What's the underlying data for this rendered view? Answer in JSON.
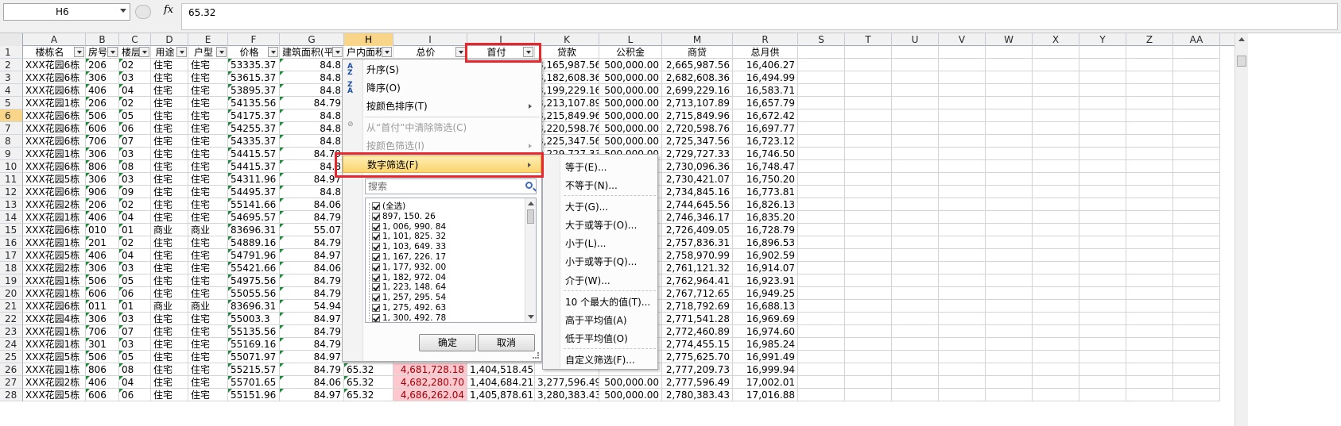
{
  "formula_bar": {
    "name_box": "H6",
    "fx": "fx",
    "value": "65.32"
  },
  "columns": [
    "A",
    "B",
    "C",
    "D",
    "E",
    "F",
    "G",
    "H",
    "I",
    "J",
    "K",
    "L",
    "M",
    "R",
    "S",
    "T",
    "U",
    "V",
    "W",
    "X",
    "Y",
    "Z",
    "AA"
  ],
  "active_column": "H",
  "active_row": "6",
  "header_row": {
    "num": "1",
    "cells": [
      "楼栋名",
      "房号",
      "楼层",
      "用途",
      "户型",
      "价格",
      "建筑面积(平",
      "户内面积",
      "总价",
      "首付",
      "贷款",
      "公积金",
      "商贷",
      "总月供"
    ]
  },
  "rows": [
    {
      "num": "2",
      "a": "XXX花园6栋",
      "b": "206",
      "c": "02",
      "d": "住宅",
      "e": "住宅",
      "f": "53335.37",
      "g": "84.8",
      "k": "3,165,987.56",
      "l": "500,000.00",
      "m": "2,665,987.56",
      "r": "16,406.27"
    },
    {
      "num": "3",
      "a": "XXX花园6栋",
      "b": "306",
      "c": "03",
      "d": "住宅",
      "e": "住宅",
      "f": "53615.37",
      "g": "84.8",
      "k": "3,182,608.36",
      "l": "500,000.00",
      "m": "2,682,608.36",
      "r": "16,494.99"
    },
    {
      "num": "4",
      "a": "XXX花园6栋",
      "b": "406",
      "c": "04",
      "d": "住宅",
      "e": "住宅",
      "f": "53895.37",
      "g": "84.8",
      "k": "3,199,229.16",
      "l": "500,000.00",
      "m": "2,699,229.16",
      "r": "16,583.71"
    },
    {
      "num": "5",
      "a": "XXX花园1栋",
      "b": "206",
      "c": "02",
      "d": "住宅",
      "e": "住宅",
      "f": "54135.56",
      "g": "84.79",
      "k": "3,213,107.89",
      "l": "500,000.00",
      "m": "2,713,107.89",
      "r": "16,657.79"
    },
    {
      "num": "6",
      "a": "XXX花园6栋",
      "b": "506",
      "c": "05",
      "d": "住宅",
      "e": "住宅",
      "f": "54175.37",
      "g": "84.8",
      "k": "3,215,849.96",
      "l": "500,000.00",
      "m": "2,715,849.96",
      "r": "16,672.42"
    },
    {
      "num": "7",
      "a": "XXX花园6栋",
      "b": "606",
      "c": "06",
      "d": "住宅",
      "e": "住宅",
      "f": "54255.37",
      "g": "84.8",
      "k": "3,220,598.76",
      "l": "500,000.00",
      "m": "2,720,598.76",
      "r": "16,697.77"
    },
    {
      "num": "8",
      "a": "XXX花园6栋",
      "b": "706",
      "c": "07",
      "d": "住宅",
      "e": "住宅",
      "f": "54335.37",
      "g": "84.8",
      "k": "3,225,347.56",
      "l": "500,000.00",
      "m": "2,725,347.56",
      "r": "16,723.12"
    },
    {
      "num": "9",
      "a": "XXX花园1栋",
      "b": "306",
      "c": "03",
      "d": "住宅",
      "e": "住宅",
      "f": "54415.57",
      "g": "84.79",
      "k": "3,229,727.33",
      "l": "500,000.00",
      "m": "2,729,727.33",
      "r": "16,746.50"
    },
    {
      "num": "10",
      "a": "XXX花园6栋",
      "b": "806",
      "c": "08",
      "d": "住宅",
      "e": "住宅",
      "f": "54415.37",
      "g": "84.8",
      "k": "",
      "l": "",
      "m": "2,730,096.36",
      "r": "16,748.47"
    },
    {
      "num": "11",
      "a": "XXX花园5栋",
      "b": "306",
      "c": "03",
      "d": "住宅",
      "e": "住宅",
      "f": "54311.96",
      "g": "84.97",
      "k": "",
      "l": "",
      "m": "2,730,421.07",
      "r": "16,750.20"
    },
    {
      "num": "12",
      "a": "XXX花园6栋",
      "b": "906",
      "c": "09",
      "d": "住宅",
      "e": "住宅",
      "f": "54495.37",
      "g": "84.8",
      "k": "",
      "l": "",
      "m": "2,734,845.16",
      "r": "16,773.81"
    },
    {
      "num": "13",
      "a": "XXX花园2栋",
      "b": "206",
      "c": "02",
      "d": "住宅",
      "e": "住宅",
      "f": "55141.66",
      "g": "84.06",
      "k": "",
      "l": "",
      "m": "2,744,645.56",
      "r": "16,826.13"
    },
    {
      "num": "14",
      "a": "XXX花园1栋",
      "b": "406",
      "c": "04",
      "d": "住宅",
      "e": "住宅",
      "f": "54695.57",
      "g": "84.79",
      "k": "",
      "l": "",
      "m": "2,746,346.17",
      "r": "16,835.20"
    },
    {
      "num": "15",
      "a": "XXX花园6栋",
      "b": "010",
      "c": "01",
      "d": "商业",
      "e": "商业",
      "f": "83696.31",
      "g": "55.07",
      "k": "",
      "l": "",
      "m": "2,726,409.05",
      "r": "16,728.79"
    },
    {
      "num": "16",
      "a": "XXX花园1栋",
      "b": "201",
      "c": "02",
      "d": "住宅",
      "e": "住宅",
      "f": "54889.16",
      "g": "84.79",
      "k": "",
      "l": "",
      "m": "2,757,836.31",
      "r": "16,896.53"
    },
    {
      "num": "17",
      "a": "XXX花园5栋",
      "b": "406",
      "c": "04",
      "d": "住宅",
      "e": "住宅",
      "f": "54791.96",
      "g": "84.97",
      "k": "",
      "l": "",
      "m": "2,758,970.99",
      "r": "16,902.59"
    },
    {
      "num": "18",
      "a": "XXX花园2栋",
      "b": "306",
      "c": "03",
      "d": "住宅",
      "e": "住宅",
      "f": "55421.66",
      "g": "84.06",
      "k": "",
      "l": "",
      "m": "2,761,121.32",
      "r": "16,914.07"
    },
    {
      "num": "19",
      "a": "XXX花园1栋",
      "b": "506",
      "c": "05",
      "d": "住宅",
      "e": "住宅",
      "f": "54975.56",
      "g": "84.79",
      "k": "",
      "l": "",
      "m": "2,762,964.41",
      "r": "16,923.91"
    },
    {
      "num": "20",
      "a": "XXX花园1栋",
      "b": "606",
      "c": "06",
      "d": "住宅",
      "e": "住宅",
      "f": "55055.56",
      "g": "84.79",
      "k": "",
      "l": "",
      "m": "2,767,712.65",
      "r": "16,949.25"
    },
    {
      "num": "21",
      "a": "XXX花园6栋",
      "b": "011",
      "c": "01",
      "d": "商业",
      "e": "商业",
      "f": "83696.31",
      "g": "54.94",
      "k": "",
      "l": "",
      "m": "2,718,792.69",
      "r": "16,688.13"
    },
    {
      "num": "22",
      "a": "XXX花园4栋",
      "b": "306",
      "c": "03",
      "d": "住宅",
      "e": "住宅",
      "f": "55003.3",
      "g": "84.97",
      "k": "",
      "l": "",
      "m": "2,771,541.28",
      "r": "16,969.69"
    },
    {
      "num": "23",
      "a": "XXX花园1栋",
      "b": "706",
      "c": "07",
      "d": "住宅",
      "e": "住宅",
      "f": "55135.56",
      "g": "84.79",
      "k": "",
      "l": "",
      "m": "2,772,460.89",
      "r": "16,974.60"
    },
    {
      "num": "24",
      "a": "XXX花园1栋",
      "b": "301",
      "c": "03",
      "d": "住宅",
      "e": "住宅",
      "f": "55169.16",
      "g": "84.79",
      "k": "",
      "l": "",
      "m": "2,774,455.15",
      "r": "16,985.24"
    },
    {
      "num": "25",
      "a": "XXX花园5栋",
      "b": "506",
      "c": "05",
      "d": "住宅",
      "e": "住宅",
      "f": "55071.97",
      "g": "84.97",
      "k": "",
      "l": "",
      "m": "2,775,625.70",
      "r": "16,991.49"
    },
    {
      "num": "26",
      "a": "XXX花园1栋",
      "b": "806",
      "c": "08",
      "d": "住宅",
      "e": "住宅",
      "f": "55215.57",
      "g": "84.79",
      "h": "65.32",
      "i": "4,681,728.18",
      "j": "1,404,518.45",
      "k": "",
      "l": "",
      "m": "2,777,209.73",
      "r": "16,999.94"
    },
    {
      "num": "27",
      "a": "XXX花园2栋",
      "b": "406",
      "c": "04",
      "d": "住宅",
      "e": "住宅",
      "f": "55701.65",
      "g": "84.06",
      "h": "65.32",
      "i": "4,682,280.70",
      "j": "1,404,684.21",
      "k": "3,277,596.49",
      "l": "500,000.00",
      "m": "2,777,596.49",
      "r": "17,002.01"
    },
    {
      "num": "28",
      "a": "XXX花园5栋",
      "b": "606",
      "c": "06",
      "d": "住宅",
      "e": "住宅",
      "f": "55151.96",
      "g": "84.97",
      "h": "65.32",
      "i": "4,686,262.04",
      "j": "1,405,878.61",
      "k": "3,280,383.43",
      "l": "500,000.00",
      "m": "2,780,383.43",
      "r": "17,016.88"
    }
  ],
  "filter_menu": {
    "sort_asc": "升序(S)",
    "sort_desc": "降序(O)",
    "sort_by_color": "按颜色排序(T)",
    "clear_filter": "从“首付”中清除筛选(C)",
    "filter_by_color": "按颜色筛选(I)",
    "number_filter": "数字筛选(F)",
    "search_placeholder": "搜索",
    "list": [
      "(全选)",
      "897, 150. 26",
      "1, 006, 990. 84",
      "1, 101, 825. 32",
      "1, 103, 649. 33",
      "1, 167, 226. 17",
      "1, 177, 932. 00",
      "1, 182, 972. 04",
      "1, 223, 148. 64",
      "1, 257, 295. 54",
      "1, 275, 492. 63",
      "1, 300, 492. 78"
    ],
    "ok": "确定",
    "cancel": "取消"
  },
  "number_filter_submenu": {
    "items": [
      "等于(E)...",
      "不等于(N)...",
      "大于(G)...",
      "大于或等于(O)...",
      "小于(L)...",
      "小于或等于(Q)...",
      "介于(W)...",
      "10 个最大的值(T)...",
      "高于平均值(A)",
      "低于平均值(O)",
      "自定义筛选(F)..."
    ]
  },
  "colors": {
    "highlight_red": "#e8262b",
    "pink_fill": "#ffc7ce",
    "active_header": "#f8d588",
    "menu_hover": "#fbd46d"
  }
}
